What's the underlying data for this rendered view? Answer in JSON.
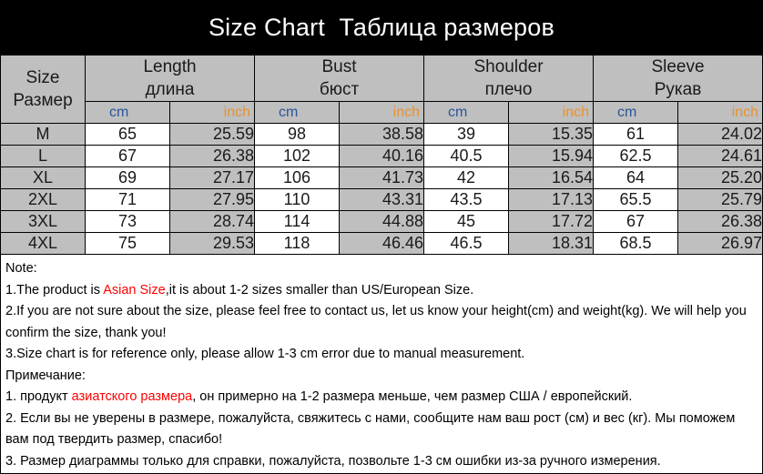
{
  "title": {
    "english": "Size Chart",
    "russian": "Таблица размеров",
    "background": "#000000",
    "color": "#ffffff"
  },
  "colors": {
    "header_gray": "#bfbfbf",
    "cm_blue": "#2a5699",
    "inch_orange": "#e8922e",
    "highlight_red": "#ff0000",
    "border": "#000000"
  },
  "table": {
    "size_header": {
      "english": "Size",
      "russian": "Размер"
    },
    "groups": [
      {
        "english": "Length",
        "russian": "длина"
      },
      {
        "english": "Bust",
        "russian": "бюст"
      },
      {
        "english": "Shoulder",
        "russian": "плечо"
      },
      {
        "english": "Sleeve",
        "russian": "Рукав"
      }
    ],
    "units": {
      "cm": "cm",
      "inch": "inch"
    },
    "rows": [
      {
        "size": "M",
        "length_cm": "65",
        "length_inch": "25.59",
        "bust_cm": "98",
        "bust_inch": "38.58",
        "shoulder_cm": "39",
        "shoulder_inch": "15.35",
        "sleeve_cm": "61",
        "sleeve_inch": "24.02"
      },
      {
        "size": "L",
        "length_cm": "67",
        "length_inch": "26.38",
        "bust_cm": "102",
        "bust_inch": "40.16",
        "shoulder_cm": "40.5",
        "shoulder_inch": "15.94",
        "sleeve_cm": "62.5",
        "sleeve_inch": "24.61"
      },
      {
        "size": "XL",
        "length_cm": "69",
        "length_inch": "27.17",
        "bust_cm": "106",
        "bust_inch": "41.73",
        "shoulder_cm": "42",
        "shoulder_inch": "16.54",
        "sleeve_cm": "64",
        "sleeve_inch": "25.20"
      },
      {
        "size": "2XL",
        "length_cm": "71",
        "length_inch": "27.95",
        "bust_cm": "110",
        "bust_inch": "43.31",
        "shoulder_cm": "43.5",
        "shoulder_inch": "17.13",
        "sleeve_cm": "65.5",
        "sleeve_inch": "25.79"
      },
      {
        "size": "3XL",
        "length_cm": "73",
        "length_inch": "28.74",
        "bust_cm": "114",
        "bust_inch": "44.88",
        "shoulder_cm": "45",
        "shoulder_inch": "17.72",
        "sleeve_cm": "67",
        "sleeve_inch": "26.38"
      },
      {
        "size": "4XL",
        "length_cm": "75",
        "length_inch": "29.53",
        "bust_cm": "118",
        "bust_inch": "46.46",
        "shoulder_cm": "46.5",
        "shoulder_inch": "18.31",
        "sleeve_cm": "68.5",
        "sleeve_inch": "26.97"
      }
    ]
  },
  "notes": {
    "en_heading": "Note:",
    "en_1_before": "1.The product is ",
    "en_1_red": "Asian Size",
    "en_1_after": ",it is about 1-2 sizes smaller than US/European Size.",
    "en_2": "2.If you are not sure about the size, please feel free to contact us, let us know your height(cm) and weight(kg). We will help you confirm the size, thank you!",
    "en_3": "3.Size chart is for reference only, please allow 1-3 cm error due to manual measurement.",
    "ru_heading": "Примечание:",
    "ru_1_before": "1. продукт ",
    "ru_1_red": "азиатского размера",
    "ru_1_after": ", он примерно на 1-2 размера меньше, чем размер США / европейский.",
    "ru_2": "2. Если вы не уверены в размере, пожалуйста, свяжитесь с нами, сообщите нам ваш рост (см) и вес (кг). Мы поможем вам под твердить размер, спасибо!",
    "ru_3": "3. Размер диаграммы только для справки, пожалуйста, позвольте 1-3 см ошибки из-за ручного измерения."
  },
  "chart_data": {
    "type": "table",
    "title": "Size Chart Таблица размеров",
    "categories": [
      "M",
      "L",
      "XL",
      "2XL",
      "3XL",
      "4XL"
    ],
    "columns": [
      "Size/Размер",
      "Length cm",
      "Length inch",
      "Bust cm",
      "Bust inch",
      "Shoulder cm",
      "Shoulder inch",
      "Sleeve cm",
      "Sleeve inch"
    ],
    "series": [
      {
        "name": "Length (cm)",
        "values": [
          65,
          67,
          69,
          71,
          73,
          75
        ]
      },
      {
        "name": "Length (inch)",
        "values": [
          25.59,
          26.38,
          27.17,
          27.95,
          28.74,
          29.53
        ]
      },
      {
        "name": "Bust (cm)",
        "values": [
          98,
          102,
          106,
          110,
          114,
          118
        ]
      },
      {
        "name": "Bust (inch)",
        "values": [
          38.58,
          40.16,
          41.73,
          43.31,
          44.88,
          46.46
        ]
      },
      {
        "name": "Shoulder (cm)",
        "values": [
          39,
          40.5,
          42,
          43.5,
          45,
          46.5
        ]
      },
      {
        "name": "Shoulder (inch)",
        "values": [
          15.35,
          15.94,
          16.54,
          17.13,
          17.72,
          18.31
        ]
      },
      {
        "name": "Sleeve (cm)",
        "values": [
          61,
          62.5,
          64,
          65.5,
          67,
          68.5
        ]
      },
      {
        "name": "Sleeve (inch)",
        "values": [
          24.02,
          24.61,
          25.2,
          25.79,
          26.38,
          26.97
        ]
      }
    ]
  }
}
